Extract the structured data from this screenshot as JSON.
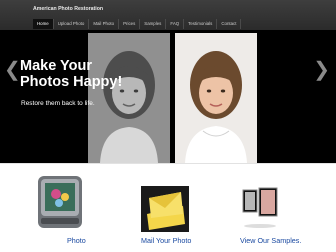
{
  "site": {
    "brand": "American Photo Restoration"
  },
  "nav": {
    "items": [
      {
        "label": "Home",
        "active": true
      },
      {
        "label": "Upload Photo",
        "active": false
      },
      {
        "label": "Mail Photo",
        "active": false
      },
      {
        "label": "Prices",
        "active": false
      },
      {
        "label": "Samples",
        "active": false
      },
      {
        "label": "FAQ",
        "active": false
      },
      {
        "label": "Testimonials",
        "active": false
      },
      {
        "label": "Contact",
        "active": false
      }
    ]
  },
  "banner": {
    "headline_line1": "Make Your",
    "headline_line2": "Photos Happy!",
    "tagline": "Restore them back to life.",
    "prev_glyph": "❮",
    "next_glyph": "❯"
  },
  "features": {
    "upload_label": "Photo",
    "mail_label": "Mail Your Photo",
    "samples_label": "View Our Samples."
  },
  "colors": {
    "header_bg": "#2f2f2f",
    "banner_bg": "#000000",
    "link": "#1a49a0"
  }
}
